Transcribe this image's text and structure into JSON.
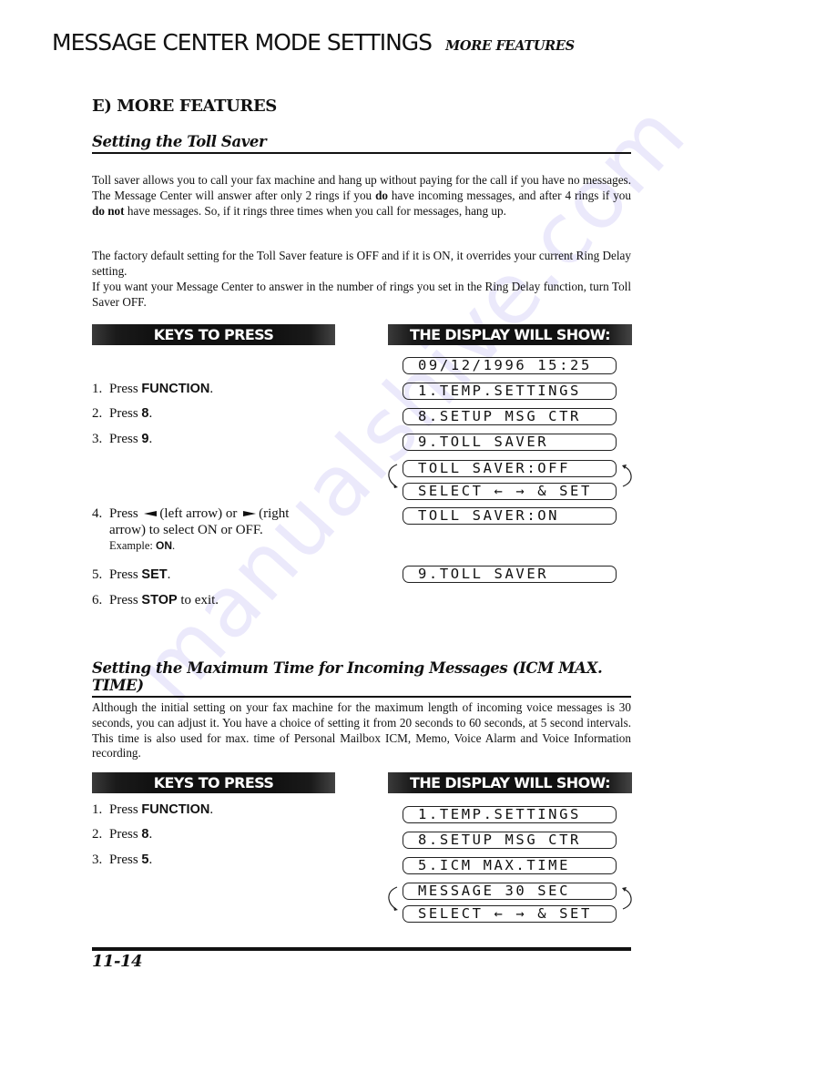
{
  "header": {
    "main_title": "MESSAGE CENTER MODE SETTINGS",
    "sub_title": "MORE FEATURES"
  },
  "section_title": "E) MORE FEATURES",
  "toll_saver": {
    "heading": "Setting the Toll Saver",
    "para1": {
      "a": "Toll saver allows you to call your fax machine and hang up without paying for the call if you have no messages. The Message Center will answer after only 2 rings if you ",
      "b": "do",
      "c": " have incoming messages, and after 4 rings if you ",
      "d": "do not",
      "e": " have messages. So, if it rings three times when you call for messages, hang up."
    },
    "para2": "The factory default setting for the Toll Saver feature is OFF and if it is ON, it overrides your current Ring Delay setting.",
    "para3": "If you want your Message Center to answer in the number of rings you set in the Ring Delay function, turn Toll Saver OFF.",
    "keys_label": "KEYS TO PRESS",
    "display_label": "THE DISPLAY WILL SHOW:",
    "steps": [
      {
        "num": "1.",
        "text": "Press ",
        "key": "FUNCTION",
        "after": "."
      },
      {
        "num": "2.",
        "text": "Press ",
        "key": "8",
        "after": "."
      },
      {
        "num": "3.",
        "text": "Press ",
        "key": "9",
        "after": "."
      },
      {
        "num": "4.",
        "text": "Press ",
        "left_arrow_text": "(left arrow) or ",
        "right_arrow_text": "(right",
        "cont": "arrow) to select ON or OFF.",
        "example_label": "Example: ",
        "example_value": "ON",
        "after": "."
      },
      {
        "num": "5.",
        "text": "Press ",
        "key": "SET",
        "after": "."
      },
      {
        "num": "6.",
        "text": "Press ",
        "key": "STOP",
        "after": " to exit."
      }
    ],
    "displays": [
      "09/12/1996 15:25",
      "1.TEMP.SETTINGS",
      "8.SETUP MSG CTR",
      "9.TOLL SAVER",
      "TOLL SAVER:OFF",
      "SELECT ← → & SET",
      "TOLL SAVER:ON",
      "9.TOLL SAVER"
    ]
  },
  "icm_max_time": {
    "heading": "Setting the Maximum Time for Incoming Messages (ICM MAX. TIME)",
    "para": "Although the initial setting on your fax machine for the maximum length of incoming voice messages is 30 seconds, you can adjust it. You have a choice of setting it from 20 seconds to 60 seconds, at 5 second intervals. This time is also used for max. time of Personal Mailbox ICM, Memo, Voice Alarm and Voice Information recording.",
    "keys_label": "KEYS TO PRESS",
    "display_label": "THE DISPLAY WILL SHOW:",
    "steps": [
      {
        "num": "1.",
        "text": "Press ",
        "key": "FUNCTION",
        "after": "."
      },
      {
        "num": "2.",
        "text": "Press ",
        "key": "8",
        "after": "."
      },
      {
        "num": "3.",
        "text": "Press ",
        "key": "5",
        "after": "."
      }
    ],
    "displays": [
      "1.TEMP.SETTINGS",
      "8.SETUP MSG CTR",
      "5.ICM MAX.TIME",
      "MESSAGE 30 SEC",
      "SELECT ← → & SET"
    ]
  },
  "footer": {
    "page_number": "11-14"
  },
  "watermark": "manualshive.com"
}
